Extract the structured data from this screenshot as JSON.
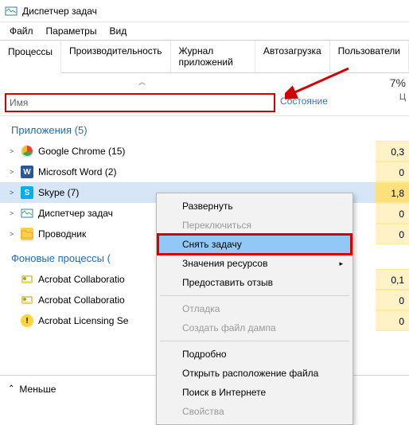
{
  "title": "Диспетчер задач",
  "menu": {
    "file": "Файл",
    "options": "Параметры",
    "view": "Вид"
  },
  "tabs": {
    "processes": "Процессы",
    "performance": "Производительность",
    "app_history": "Журнал приложений",
    "startup": "Автозагрузка",
    "users": "Пользователи"
  },
  "headers": {
    "name": "Имя",
    "state": "Состояние",
    "cpu_value": "7%",
    "cpu_sub": "Ц"
  },
  "groups": {
    "apps": "Приложения (5)",
    "background": "Фоновые процессы ("
  },
  "rows": {
    "chrome": "Google Chrome (15)",
    "word": "Microsoft Word (2)",
    "skype": "Skype (7)",
    "taskmgr": "Диспетчер задач",
    "explorer": "Проводник",
    "acrobat1": "Acrobat Collaboratio",
    "acrobat2": "Acrobat Collaboratio",
    "acrobat3": "Acrobat Licensing Se"
  },
  "cpu": {
    "chrome": "0,3",
    "word": "0",
    "skype": "1,8",
    "taskmgr": "0",
    "explorer": "0",
    "acrobat1": "0,1",
    "acrobat2": "0",
    "acrobat3": "0"
  },
  "context": {
    "expand": "Развернуть",
    "switch": "Переключиться",
    "end_task": "Снять задачу",
    "resource_values": "Значения ресурсов",
    "feedback": "Предоставить отзыв",
    "debug": "Отладка",
    "dump": "Создать файл дампа",
    "details": "Подробно",
    "open_location": "Открыть расположение файла",
    "search_online": "Поиск в Интернете",
    "properties": "Свойства"
  },
  "bottom": {
    "less": "Меньше"
  }
}
